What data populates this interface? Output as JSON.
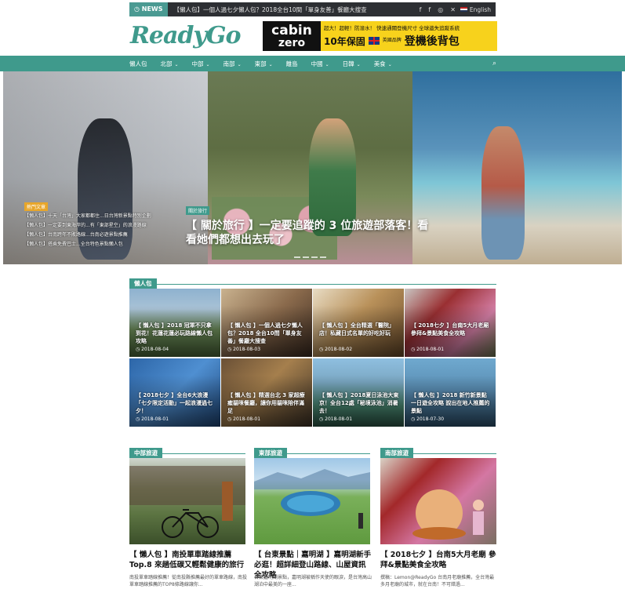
{
  "topbar": {
    "news_label": "NEWS",
    "ticker": "【懶人包】一個人過七夕懶人包？2018全台10間「單身友善」餐廳大搜查",
    "social_icons": [
      "facebook-icon",
      "facebook-icon",
      "instagram-icon",
      "twitter-icon"
    ],
    "language": "English"
  },
  "header": {
    "logo": "ReadyGo",
    "ad": {
      "brand_line1": "cabin",
      "brand_line2": "zero",
      "top_text": "超大！超輕！防潑水！ 快速通關登機尺寸 全球遺失追蹤系統",
      "warranty": "10年保固",
      "origin": "英國品牌",
      "product": "登機後背包"
    }
  },
  "nav": {
    "items": [
      {
        "label": "懶人包",
        "dropdown": false
      },
      {
        "label": "北部",
        "dropdown": true
      },
      {
        "label": "中部",
        "dropdown": true
      },
      {
        "label": "南部",
        "dropdown": true
      },
      {
        "label": "東部",
        "dropdown": true
      },
      {
        "label": "離島",
        "dropdown": false
      },
      {
        "label": "中國",
        "dropdown": true
      },
      {
        "label": "日韓",
        "dropdown": true
      },
      {
        "label": "美食",
        "dropdown": true
      }
    ]
  },
  "hero": {
    "featured_badge": "熱門文章",
    "featured_list": [
      "【懶人包】十天「台灣」大家都都住...日台灣新景點特別企劃",
      "【懶人包】一定要到東海岸的...有「東部星空」的浪漫路線",
      "【懶人包】台南跨年不敗路線...台南必遊景點推薦",
      "【懶人包】搭乘免費巴士...全台特色景點懶人包"
    ],
    "category": "關於旅行",
    "title": "【 關於旅行 】一定要追蹤的 3 位旅遊部落客！看看她們都想出去玩了"
  },
  "sections": {
    "lazy_pack": "懶人包",
    "central": "中部旅遊",
    "east": "東部旅遊",
    "south": "南部旅遊"
  },
  "grid": [
    {
      "title": "【 懶人包 】2018 冠軍不只拿到花！花蓮花蓮必玩路線懶人包攻略",
      "date": "2018-08-04"
    },
    {
      "title": "【 懶人包 】一個人過七夕懶人包？2018 全台10間「單身友善」餐廳大搜查",
      "date": "2018-08-03"
    },
    {
      "title": "【 懶人包 】全台精選「醫院」店！私藏日式名單的好吃好玩",
      "date": "2018-08-02"
    },
    {
      "title": "【 2018七夕 】台南5大月老廟 參拜&景點美食全攻略",
      "date": "2018-08-01"
    },
    {
      "title": "【 2018七夕 】全台6大浪漫「七夕限定活動」一起浪漫過七夕！",
      "date": "2018-08-01"
    },
    {
      "title": "【 懶人包 】精選台北 3 家超療癒貓咪餐廳，讓你用貓咪陪伴滿足",
      "date": "2018-08-01"
    },
    {
      "title": "【 懶人包 】2018夏日泳池大東京！全台12處「秘境泳池」消暑去！",
      "date": "2018-08-01"
    },
    {
      "title": "【 懶人包 】2018 新竹新景點一日遊全攻略 說出在地人推薦的景點",
      "date": "2018-07-30"
    }
  ],
  "columns": [
    {
      "title": "【 懶人包 】南投單車踏線推薦 Top.8 來趟低碳又輕鬆健康的旅行",
      "excerpt": "南投單車踏線推薦！從南投縣推薦最好的單車路線，南投單車踏線推薦的TOP8條路線讓你..."
    },
    {
      "title": "【 台東景點｜嘉明湖 】嘉明湖新手必逛！超詳細登山路線、山屋資訊全攻略",
      "excerpt": "台東嘉明湖景點，嘉明湖被稱作天使的眼淚，是台灣高山湖泊中最美的一座..."
    },
    {
      "title": "【 2018七夕 】台南5大月老廟 參拜&景點美食全攻略",
      "excerpt": "撰稿：Lemon@ReadyGo 台南月老廟推薦，全台灣最多月老廟的城市，就在台南！不可錯過..."
    }
  ],
  "colors": {
    "accent": "#3f9a8c",
    "topbar": "#2d2f33",
    "featured_badge": "#e8a62a",
    "ad_yellow": "#f7d21c"
  }
}
